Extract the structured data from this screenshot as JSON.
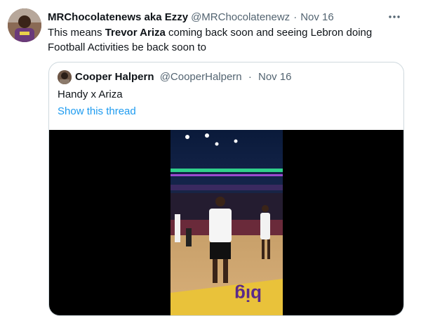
{
  "tweet": {
    "author_name": "MRChocolatenews aka Ezzy",
    "author_handle": "@MRChocolatenewz",
    "separator": "·",
    "date": "Nov 16",
    "text_prefix": "This means ",
    "text_bold": "Trevor Ariza",
    "text_suffix": " coming back soon and seeing Lebron doing Football Activities be back soon to"
  },
  "quoted": {
    "author_name": "Cooper Halpern",
    "author_handle": "@CooperHalpern",
    "separator": "·",
    "date": "Nov 16",
    "text": "Handy x Ariza",
    "show_thread": "Show this thread"
  },
  "icons": {
    "more": "more-horizontal-icon"
  },
  "colors": {
    "link": "#1d9bf0",
    "secondary_text": "#536471",
    "border": "#cfd9de"
  }
}
